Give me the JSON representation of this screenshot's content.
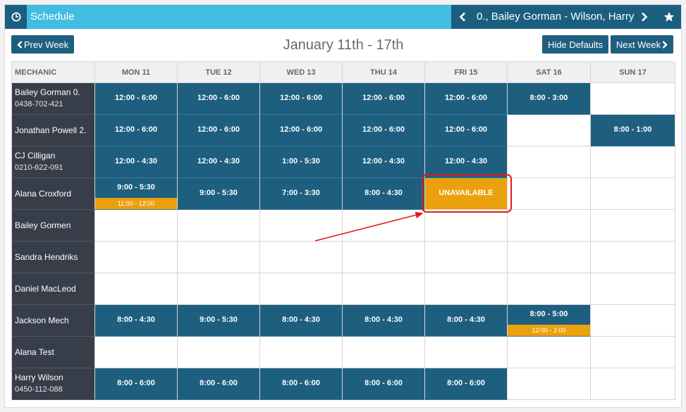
{
  "app": {
    "title": "Schedule",
    "clock_icon": "clock-icon",
    "nav": {
      "prev_icon": "chevron-left-icon",
      "label": "0., Bailey Gorman - Wilson, Harry",
      "next_icon": "chevron-right-icon",
      "star_icon": "star-icon"
    }
  },
  "toolbar": {
    "prev_week": "Prev Week",
    "hide_defaults": "Hide Defaults",
    "next_week": "Next Week",
    "week_title": "January 11th - 17th"
  },
  "colors": {
    "header": "#41bde2",
    "header_dark": "#1b5f80",
    "shift": "#1e5f80",
    "mechanic_bg": "#373e4a",
    "unavailable": "#eba10d",
    "annotation": "#e01b1b"
  },
  "columns": [
    "MECHANIC",
    "MON 11",
    "TUE 12",
    "WED 13",
    "THU 14",
    "FRI 15",
    "SAT 16",
    "SUN 17"
  ],
  "rows": [
    {
      "name": "Bailey Gorman 0.",
      "phone": "0438-702-421",
      "days": [
        {
          "time": "12:00 - 6:00"
        },
        {
          "time": "12:00 - 6:00"
        },
        {
          "time": "12:00 - 6:00"
        },
        {
          "time": "12:00 - 6:00"
        },
        {
          "time": "12:00 - 6:00"
        },
        {
          "time": "8:00 - 3:00"
        },
        null
      ]
    },
    {
      "name": "Jonathan Powell 2.",
      "phone": "",
      "days": [
        {
          "time": "12:00 - 6:00"
        },
        {
          "time": "12:00 - 6:00"
        },
        {
          "time": "12:00 - 6:00"
        },
        {
          "time": "12:00 - 6:00"
        },
        {
          "time": "12:00 - 6:00"
        },
        null,
        {
          "time": "8:00 - 1:00"
        }
      ]
    },
    {
      "name": "CJ Cilligan",
      "phone": "0210-622-091",
      "days": [
        {
          "time": "12:00 - 4:30"
        },
        {
          "time": "12:00 - 4:30"
        },
        {
          "time": "1:00 - 5:30"
        },
        {
          "time": "12:00 - 4:30"
        },
        {
          "time": "12:00 - 4:30"
        },
        null,
        null
      ]
    },
    {
      "name": "Alana Croxford",
      "phone": "",
      "days": [
        {
          "time": "9:00 - 5:30",
          "sub": "11:00 - 12:00"
        },
        {
          "time": "9:00 - 5:30"
        },
        {
          "time": "7:00 - 3:30"
        },
        {
          "time": "8:00 - 4:30"
        },
        {
          "time": "UNAVAILABLE",
          "unavailable": true
        },
        null,
        null
      ]
    },
    {
      "name": "Bailey Gormen",
      "phone": "",
      "days": [
        null,
        null,
        null,
        null,
        null,
        null,
        null
      ]
    },
    {
      "name": "Sandra Hendriks",
      "phone": "",
      "days": [
        null,
        null,
        null,
        null,
        null,
        null,
        null
      ]
    },
    {
      "name": "Daniel MacLeod",
      "phone": "",
      "days": [
        null,
        null,
        null,
        null,
        null,
        null,
        null
      ]
    },
    {
      "name": "Jackson Mech",
      "phone": "",
      "days": [
        {
          "time": "8:00 - 4:30"
        },
        {
          "time": "9:00 - 5:30"
        },
        {
          "time": "8:00 - 4:30"
        },
        {
          "time": "8:00 - 4:30"
        },
        {
          "time": "8:00 - 4:30"
        },
        {
          "time": "8:00 - 5:00",
          "sub": "12:00 - 2:00"
        },
        null
      ]
    },
    {
      "name": "Alana Test",
      "phone": "",
      "days": [
        null,
        null,
        null,
        null,
        null,
        null,
        null
      ]
    },
    {
      "name": "Harry Wilson",
      "phone": "0450-112-088",
      "days": [
        {
          "time": "8:00 - 6:00"
        },
        {
          "time": "8:00 - 6:00"
        },
        {
          "time": "8:00 - 6:00"
        },
        {
          "time": "8:00 - 6:00"
        },
        {
          "time": "8:00 - 6:00"
        },
        null,
        null
      ]
    }
  ]
}
